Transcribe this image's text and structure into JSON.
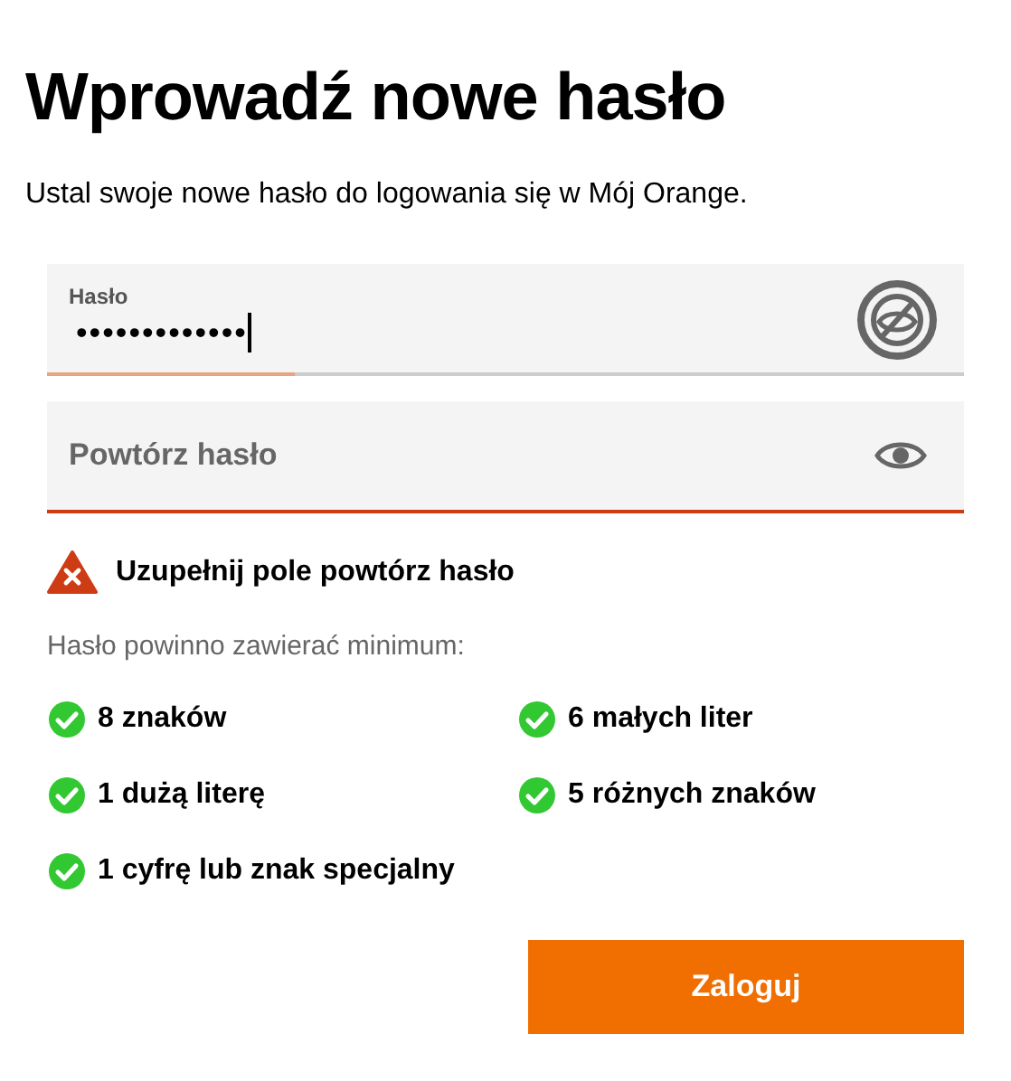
{
  "title": "Wprowadź nowe hasło",
  "subtitle": "Ustal swoje nowe hasło do logowania się w Mój Orange.",
  "fields": [
    {
      "label": "Hasło",
      "value": "•••••••••••••",
      "focused": true,
      "strength": {
        "level": 0.27
      },
      "error": false
    },
    {
      "placeholder": "Powtórz hasło",
      "error": true
    }
  ],
  "error_message": "Uzupełnij pole powtórz hasło",
  "requirements_intro": "Hasło powinno zawierać minimum:",
  "requirements": [
    {
      "text": "8 znaków",
      "met": true
    },
    {
      "text": "6 małych liter",
      "met": true
    },
    {
      "text": "1 dużą literę",
      "met": true
    },
    {
      "text": "5 różnych znaków",
      "met": true
    },
    {
      "text": "1 cyfrę lub znak specjalny",
      "met": true
    }
  ],
  "submit": {
    "label": "Zaloguj"
  }
}
